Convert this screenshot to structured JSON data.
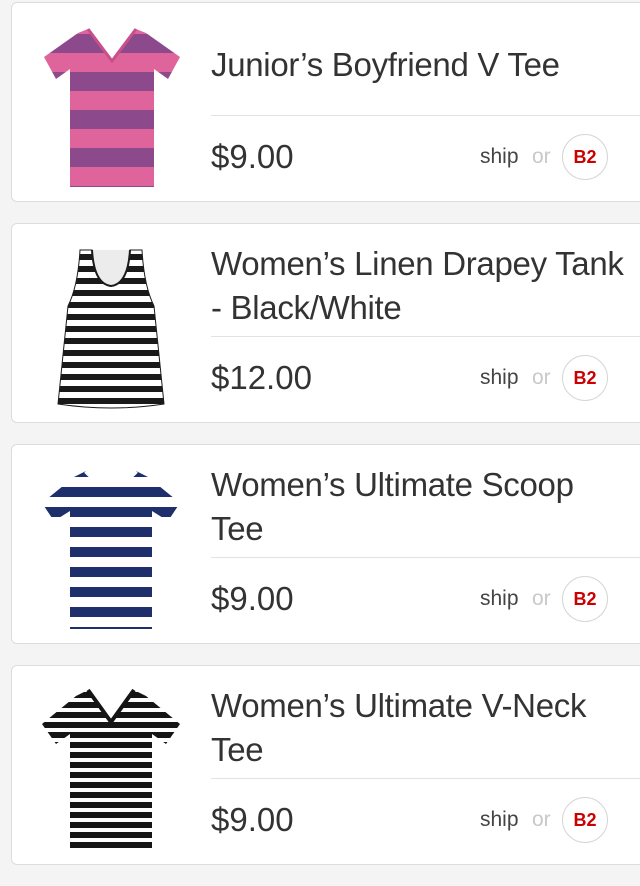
{
  "products": [
    {
      "title": "Junior’s Boyfriend V Tee",
      "price": "$9.00",
      "ship_label": "ship",
      "or_label": "or",
      "store_label": "B2",
      "image_icon": "pink-striped-v-tee-image",
      "colors": {
        "stripe_a": "#e0649c",
        "stripe_b": "#8c4a8c"
      }
    },
    {
      "title": "Women’s Linen Drapey Tank - Black/White",
      "price": "$12.00",
      "ship_label": "ship",
      "or_label": "or",
      "store_label": "B2",
      "image_icon": "black-white-striped-tank-image",
      "colors": {
        "stripe_a": "#ffffff",
        "stripe_b": "#1a1a1a"
      }
    },
    {
      "title": "Women’s Ultimate Scoop Tee",
      "price": "$9.00",
      "ship_label": "ship",
      "or_label": "or",
      "store_label": "B2",
      "image_icon": "navy-white-striped-scoop-tee-image",
      "colors": {
        "stripe_a": "#ffffff",
        "stripe_b": "#1f2f6b"
      }
    },
    {
      "title": "Women’s Ultimate V-Neck Tee",
      "price": "$9.00",
      "ship_label": "ship",
      "or_label": "or",
      "store_label": "B2",
      "image_icon": "black-white-striped-v-tee-image",
      "colors": {
        "stripe_a": "#ffffff",
        "stripe_b": "#151515"
      }
    }
  ],
  "accent_color": "#cc0000"
}
